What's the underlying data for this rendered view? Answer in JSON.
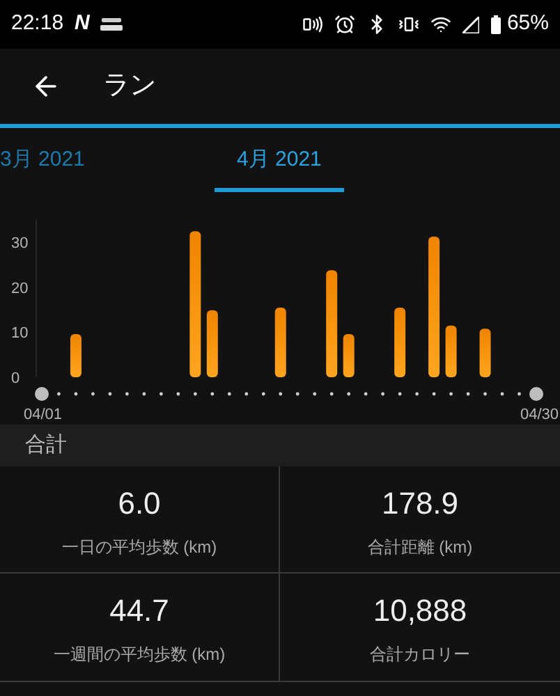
{
  "status_bar": {
    "time": "22:18",
    "notification_letter": "N",
    "battery": "65%"
  },
  "app_bar": {
    "title": "ラン"
  },
  "tabs": [
    {
      "label": "3月 2021",
      "selected": false
    },
    {
      "label": "4月 2021",
      "selected": true
    }
  ],
  "chart_data": {
    "type": "bar",
    "categories": [
      "04/01",
      null,
      null,
      null,
      null,
      null,
      null,
      null,
      null,
      null,
      null,
      null,
      null,
      null,
      null,
      null,
      null,
      null,
      null,
      null,
      null,
      null,
      null,
      null,
      null,
      null,
      null,
      null,
      null,
      "04/30"
    ],
    "values": [
      null,
      null,
      9.6,
      null,
      null,
      null,
      null,
      null,
      null,
      32.5,
      14.9,
      null,
      null,
      null,
      15.5,
      null,
      null,
      23.8,
      9.6,
      null,
      null,
      15.5,
      null,
      31.3,
      11.5,
      null,
      10.8,
      null,
      null,
      null
    ],
    "ylim": [
      0,
      35
    ],
    "yticks": [
      0,
      10,
      20,
      30
    ]
  },
  "totals": {
    "title": "合計",
    "stats": [
      {
        "value": "6.0",
        "label": "一日の平均歩数 (km)"
      },
      {
        "value": "178.9",
        "label": "合計距離 (km)"
      },
      {
        "value": "44.7",
        "label": "一週間の平均歩数 (km)"
      },
      {
        "value": "10,888",
        "label": "合計カロリー"
      }
    ]
  }
}
